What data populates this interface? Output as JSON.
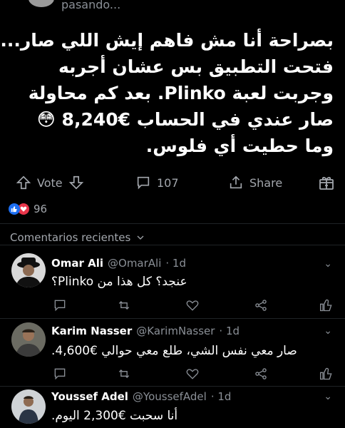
{
  "header": {
    "status_text": "pasando..."
  },
  "post": {
    "lines": [
      "بصراحة أنا مش فاهم إيش اللي صار...",
      "فتحت التطبيق بس عشان أجربه",
      "وجربت لعبة Plinko. بعد كم محاولة",
      "صار عندي في الحساب €8,240 😳",
      "وما حطيت أي فلوس."
    ]
  },
  "actions": {
    "vote_label": "Vote",
    "comment_count": "107",
    "share_label": "Share"
  },
  "reactions": {
    "count": "96",
    "colors": {
      "like": "#1d6ff2",
      "heart": "#e8354a"
    }
  },
  "comments_section": {
    "label": "Comentarios recientes"
  },
  "comments": [
    {
      "name": "Omar Ali",
      "handle": "@OmarAli",
      "time": "· 1d",
      "text": "عنجد؟ كل هذا من Plinko؟"
    },
    {
      "name": "Karim Nasser",
      "handle": "@KarimNasser",
      "time": "· 1d",
      "text": "صار معي نفس الشي، طلع معي حوالي €4,600."
    },
    {
      "name": "Youssef Adel",
      "handle": "@YoussefAdel",
      "time": "· 1d",
      "text": "أنا سحبت €2,300 اليوم."
    }
  ]
}
